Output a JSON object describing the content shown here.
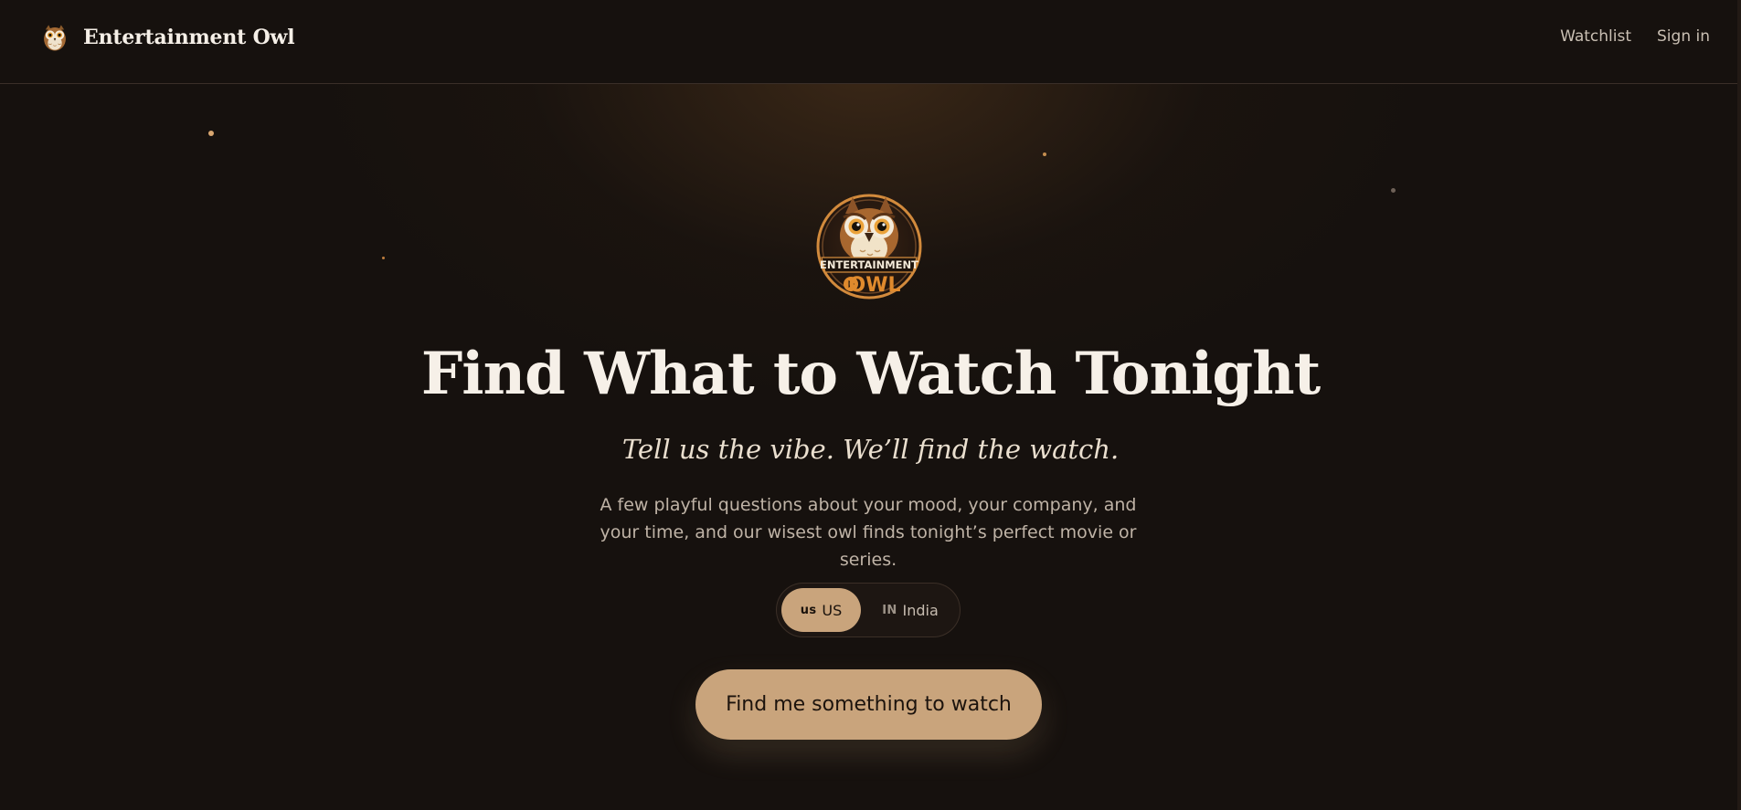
{
  "brand": {
    "name": "Entertainment Owl",
    "logo_icon": "owl-logo-icon"
  },
  "nav": {
    "watchlist": "Watchlist",
    "sign_in": "Sign in"
  },
  "hero": {
    "logo_icon": "entertainment-owl-badge",
    "logo_text_top": "ENTERTAINMENT",
    "logo_text_bottom": "OWL",
    "headline": "Find What to Watch Tonight",
    "tagline": "Tell us the vibe. We’ll find the watch.",
    "description": "A few playful questions about your mood, your company, and your time, and our wisest owl finds tonight’s perfect movie or series."
  },
  "region": {
    "options": [
      {
        "code": "us",
        "label": "US",
        "selected": true
      },
      {
        "code": "IN",
        "label": "India",
        "selected": false
      }
    ]
  },
  "cta": {
    "label": "Find me something to watch"
  },
  "colors": {
    "background": "#16110e",
    "accent": "#c9a47c",
    "text_primary": "#f6f0e8",
    "text_secondary": "#bfb3a6"
  }
}
